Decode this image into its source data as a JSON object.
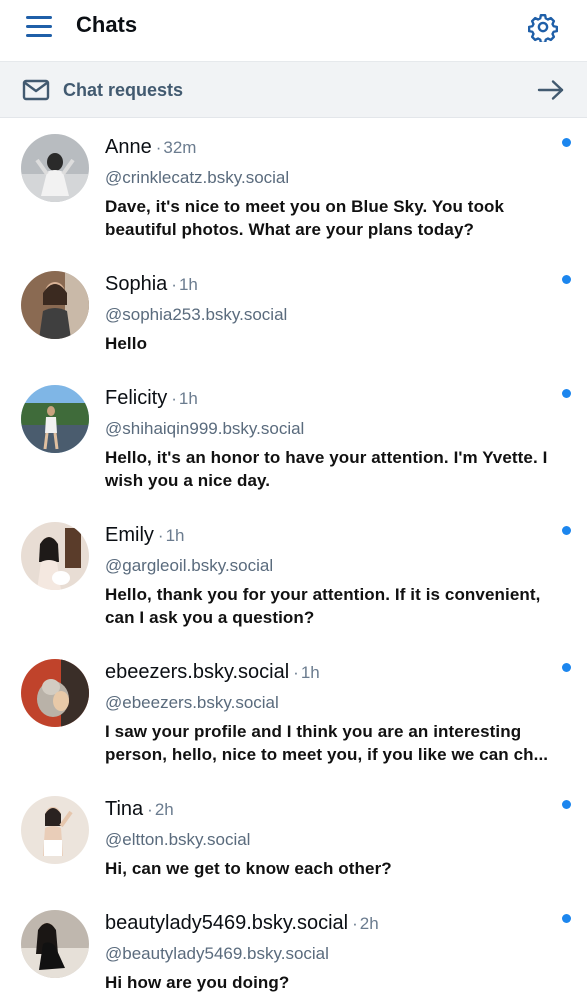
{
  "header": {
    "title": "Chats",
    "menu_icon": "hamburger-menu-icon",
    "settings_icon": "gear-icon"
  },
  "requests": {
    "label": "Chat requests",
    "icon": "envelope-icon",
    "arrow_icon": "arrow-right-icon"
  },
  "colors": {
    "accent": "#1f5fa8",
    "unread_dot": "#1c86ee",
    "requests_bg": "#f1f3f5",
    "muted_text": "#6b7c8f"
  },
  "chats": [
    {
      "name": "Anne",
      "separator": "·",
      "time": "32m",
      "handle": "@crinklecatz.bsky.social",
      "message": "Dave, it's nice to meet you on Blue Sky. You took beautiful photos. What are your plans today?",
      "unread": true
    },
    {
      "name": "Sophia",
      "separator": "·",
      "time": "1h",
      "handle": "@sophia253.bsky.social",
      "message": "Hello",
      "unread": true
    },
    {
      "name": "Felicity",
      "separator": "·",
      "time": "1h",
      "handle": "@shihaiqin999.bsky.social",
      "message": "Hello, it's an honor to have your attention. I'm Yvette. I wish you a nice day.",
      "unread": true
    },
    {
      "name": "Emily",
      "separator": "·",
      "time": "1h",
      "handle": "@gargleoil.bsky.social",
      "message": "Hello, thank you for your attention. If it is convenient, can I ask you a question?",
      "unread": true
    },
    {
      "name": "ebeezers.bsky.social",
      "separator": "·",
      "time": "1h",
      "handle": "@ebeezers.bsky.social",
      "message": "I saw your profile and I think you are an interesting person, hello, nice to meet you, if you like we can ch...",
      "unread": true
    },
    {
      "name": "Tina",
      "separator": "·",
      "time": "2h",
      "handle": "@eltton.bsky.social",
      "message": "Hi, can we get to know each other?",
      "unread": true
    },
    {
      "name": "beautylady5469.bsky.social",
      "separator": "·",
      "time": "2h",
      "handle": "@beautylady5469.bsky.social",
      "message": "Hi how are you doing?",
      "unread": true
    }
  ]
}
